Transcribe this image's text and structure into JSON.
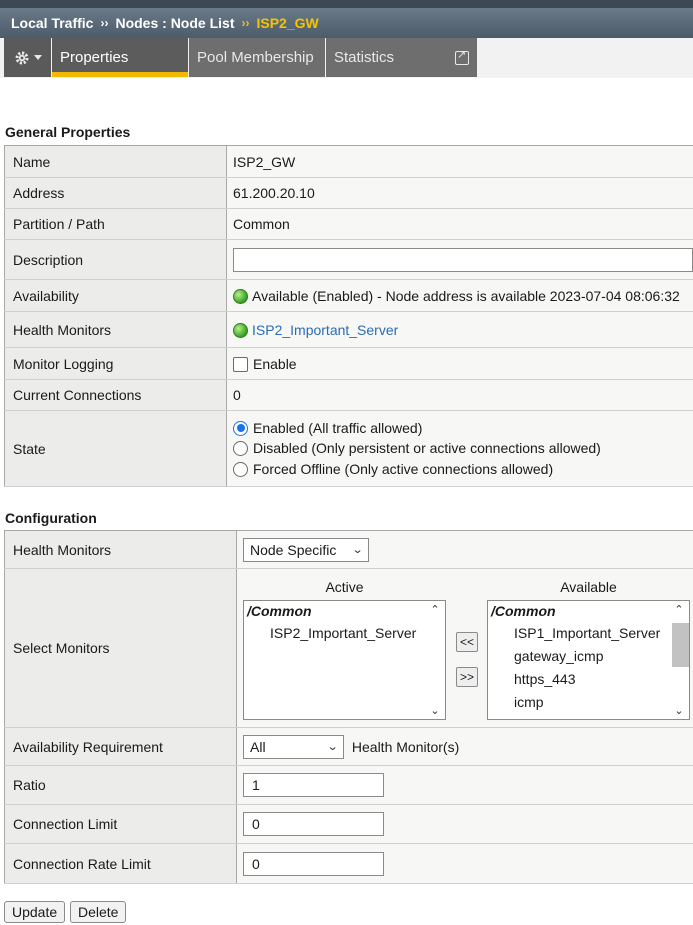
{
  "breadcrumb": {
    "items": [
      "Local Traffic",
      "Nodes : Node List",
      "ISP2_GW"
    ],
    "separator": "››"
  },
  "tabs": {
    "gear_icon": "gear-icon",
    "items": [
      "Properties",
      "Pool Membership",
      "Statistics"
    ],
    "active": "Properties"
  },
  "general": {
    "title": "General Properties",
    "rows": {
      "name": {
        "label": "Name",
        "value": "ISP2_GW"
      },
      "address": {
        "label": "Address",
        "value": "61.200.20.10"
      },
      "partition": {
        "label": "Partition / Path",
        "value": "Common"
      },
      "description": {
        "label": "Description",
        "value": ""
      },
      "availability": {
        "label": "Availability",
        "value": "Available (Enabled) - Node address is available 2023-07-04 08:06:32"
      },
      "health_monitors": {
        "label": "Health Monitors",
        "value": "ISP2_Important_Server"
      },
      "monitor_logging": {
        "label": "Monitor Logging",
        "checkbox_label": "Enable",
        "checked": false
      },
      "current_connections": {
        "label": "Current Connections",
        "value": "0"
      },
      "state": {
        "label": "State",
        "options": [
          "Enabled (All traffic allowed)",
          "Disabled (Only persistent or active connections allowed)",
          "Forced Offline (Only active connections allowed)"
        ],
        "selected": 0
      }
    }
  },
  "configuration": {
    "title": "Configuration",
    "health_monitors": {
      "label": "Health Monitors",
      "selected": "Node Specific"
    },
    "select_monitors": {
      "label": "Select Monitors",
      "active_header": "Active",
      "available_header": "Available",
      "group": "/Common",
      "active_items": [
        "ISP2_Important_Server"
      ],
      "available_items": [
        "ISP1_Important_Server",
        "gateway_icmp",
        "https_443",
        "icmp"
      ],
      "move_left": "<<",
      "move_right": ">>"
    },
    "availability_requirement": {
      "label": "Availability Requirement",
      "selected": "All",
      "suffix": "Health Monitor(s)"
    },
    "ratio": {
      "label": "Ratio",
      "value": "1"
    },
    "connection_limit": {
      "label": "Connection Limit",
      "value": "0"
    },
    "connection_rate_limit": {
      "label": "Connection Rate Limit",
      "value": "0"
    }
  },
  "buttons": {
    "update": "Update",
    "delete": "Delete"
  },
  "colors": {
    "accent": "#f5b800",
    "link": "#2a6cb8",
    "status_green": "#3fa52a"
  }
}
